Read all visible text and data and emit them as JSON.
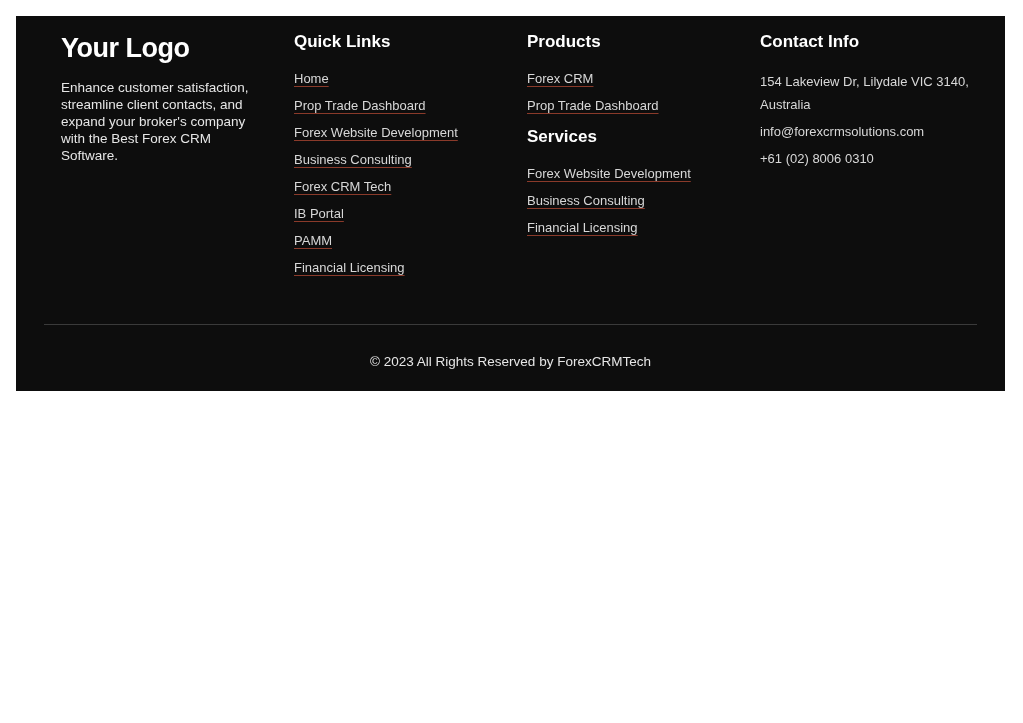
{
  "brand": {
    "logo": "Your Logo",
    "description": "Enhance customer satisfaction, streamline client contacts, and expand your broker's company with the Best Forex CRM Software."
  },
  "columns": [
    {
      "sections": [
        {
          "heading": "Quick Links",
          "links": [
            "Home",
            "Prop Trade Dashboard",
            "Forex Website Development",
            "Business Consulting",
            "Forex CRM Tech",
            "IB Portal",
            "PAMM",
            "Financial Licensing"
          ]
        }
      ]
    },
    {
      "sections": [
        {
          "heading": "Products",
          "links": [
            "Forex CRM",
            "Prop Trade Dashboard"
          ]
        },
        {
          "heading": "Services",
          "links": [
            "Forex Website Development",
            "Business Consulting",
            "Financial Licensing"
          ]
        }
      ]
    }
  ],
  "contact": {
    "heading": "Contact Info",
    "lines": [
      "154 Lakeview Dr, Lilydale VIC 3140, Australia",
      "info@forexcrmsolutions.com",
      "+61 (02) 8006 0310"
    ]
  },
  "copyright": "© 2023 All Rights Reserved by ForexCRMTech"
}
